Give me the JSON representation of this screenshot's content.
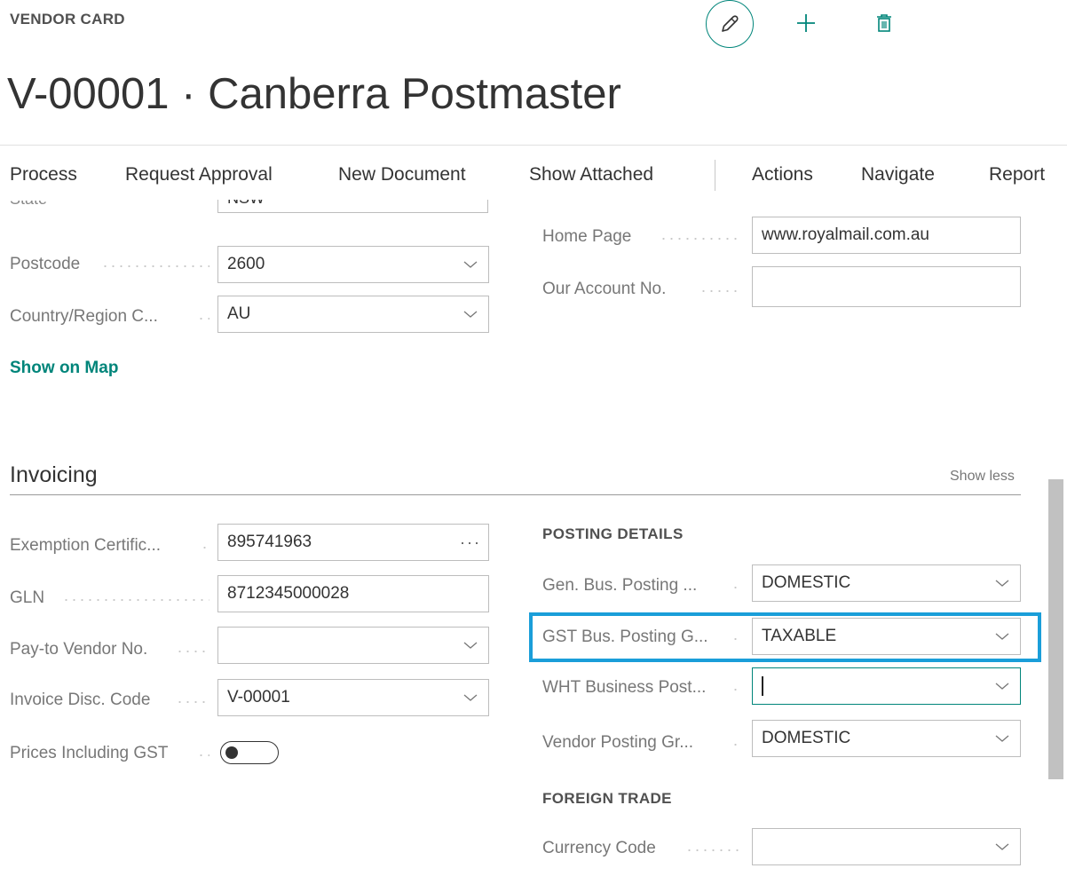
{
  "header": {
    "page_type": "VENDOR CARD",
    "title": "V-00001 · Canberra Postmaster",
    "icons": [
      "pencil-icon",
      "plus-icon",
      "trash-icon"
    ]
  },
  "actionbar": {
    "items": [
      "Process",
      "Request Approval",
      "New Document",
      "Show Attached",
      "Actions",
      "Navigate",
      "Report"
    ]
  },
  "address": {
    "state_label": "State",
    "state_value": "NSW",
    "postcode_label": "Postcode",
    "postcode_value": "2600",
    "country_label": "Country/Region C...",
    "country_value": "AU",
    "home_page_label": "Home Page",
    "home_page_value": "www.royalmail.com.au",
    "account_label": "Our Account No.",
    "account_value": "",
    "show_on_map": "Show on Map"
  },
  "invoicing": {
    "title": "Invoicing",
    "show_less": "Show less",
    "left": [
      {
        "label": "Exemption Certific...",
        "value": "895741963",
        "control": "ellipsis"
      },
      {
        "label": "GLN",
        "value": "8712345000028",
        "control": "text"
      },
      {
        "label": "Pay-to Vendor No.",
        "value": "",
        "control": "dropdown"
      },
      {
        "label": "Invoice Disc. Code",
        "value": "V-00001",
        "control": "dropdown"
      }
    ],
    "prices_incl_label": "Prices Including GST",
    "prices_incl_on": false,
    "posting_details_heading": "POSTING DETAILS",
    "posting": [
      {
        "label": "Gen. Bus. Posting ...",
        "value": "DOMESTIC"
      },
      {
        "label": "GST Bus. Posting G...",
        "value": "TAXABLE"
      },
      {
        "label": "WHT Business Post...",
        "value": ""
      },
      {
        "label": "Vendor Posting Gr...",
        "value": "DOMESTIC"
      }
    ],
    "foreign_trade_heading": "FOREIGN TRADE",
    "currency_label": "Currency Code",
    "currency_value": ""
  },
  "colors": {
    "accent": "#00857a",
    "highlight": "#1a9ed9"
  }
}
